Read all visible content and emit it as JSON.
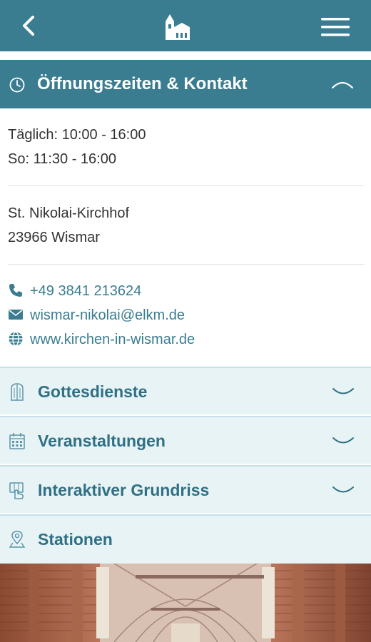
{
  "header": {
    "back_icon": "back-arrow-icon",
    "logo_icon": "church-icon",
    "menu_icon": "hamburger-menu-icon",
    "color": "#3a7d91"
  },
  "opening_section": {
    "title": "Öffnungszeiten & Kontakt",
    "icon": "clock-icon",
    "expanded": true,
    "hours": [
      "Täglich: 10:00 - 16:00",
      "So: 11:30 - 16:00"
    ],
    "address": [
      "St. Nikolai-Kirchhof",
      "23966 Wismar"
    ],
    "phone": "+49 3841 213624",
    "email": "wismar-nikolai@elkm.de",
    "website": "www.kirchen-in-wismar.de"
  },
  "sections": [
    {
      "label": "Gottesdienste",
      "icon": "church-door-icon",
      "expandable": true
    },
    {
      "label": "Veranstaltungen",
      "icon": "calendar-icon",
      "expandable": true
    },
    {
      "label": "Interaktiver Grundriss",
      "icon": "floorplan-hand-icon",
      "expandable": true
    },
    {
      "label": "Stationen",
      "icon": "location-pin-icon",
      "expandable": false
    }
  ],
  "image": {
    "subject": "church-nave-photo"
  }
}
